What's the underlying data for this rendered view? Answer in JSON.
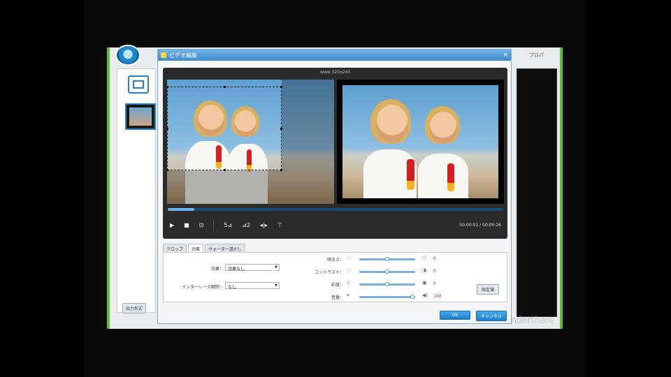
{
  "background_app": {
    "right_tab_label": "プロパ",
    "footer_button_label": "出力形式",
    "watermark_text": "Wondershare"
  },
  "dialog": {
    "title": "ビデオ編集",
    "close_symbol": "×",
    "preview": {
      "resolution_label": "www 320x240",
      "seek_progress_fraction": 0.08,
      "controls": {
        "play": "▶",
        "stop": "■",
        "snapshot": "⊡",
        "rotate_left": "5⊿",
        "rotate_right": "⊿2",
        "flip_h": "◂|▸",
        "flip_v": "⊤"
      },
      "time_current": "00:00:01",
      "time_total": "00:00:26"
    },
    "tabs": [
      {
        "label": "クロップ"
      },
      {
        "label": "効果"
      },
      {
        "label": "ウォーター透かし"
      }
    ],
    "effect": {
      "effect_label": "効果：",
      "effect_value": "効果なし",
      "deinterlace_label": "インターレース解除：",
      "deinterlace_value": "なし",
      "sliders": [
        {
          "label": "明るさ：",
          "value_fraction": 0.5,
          "value_text": "0"
        },
        {
          "label": "コントラスト：",
          "value_fraction": 0.5,
          "value_text": "0"
        },
        {
          "label": "彩度：",
          "value_fraction": 0.5,
          "value_text": "0"
        },
        {
          "label": "音量：",
          "value_fraction": 0.95,
          "value_text": "100"
        }
      ],
      "default_button_label": "既定値"
    },
    "ok_label": "OK",
    "cancel_label": "キャンセル"
  }
}
